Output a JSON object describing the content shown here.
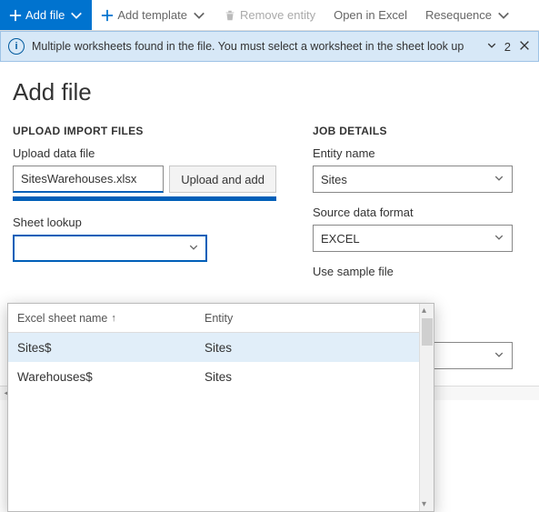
{
  "toolbar": {
    "add_file": "Add file",
    "add_template": "Add template",
    "remove_entity": "Remove entity",
    "open_in_excel": "Open in Excel",
    "resequence": "Resequence"
  },
  "messagebar": {
    "text": "Multiple worksheets found in the file. You must select a worksheet in the sheet look up",
    "count": "2"
  },
  "page": {
    "title": "Add file"
  },
  "upload": {
    "section": "UPLOAD IMPORT FILES",
    "file_label": "Upload data file",
    "file_value": "SitesWarehouses.xlsx",
    "upload_add": "Upload and add",
    "sheet_lookup_label": "Sheet lookup",
    "sheet_lookup_value": ""
  },
  "job": {
    "section": "JOB DETAILS",
    "entity_label": "Entity name",
    "entity_value": "Sites",
    "source_format_label": "Source data format",
    "source_format_value": "EXCEL",
    "use_sample_label": "Use sample file"
  },
  "lookup": {
    "col1": "Excel sheet name",
    "col2": "Entity",
    "rows": [
      {
        "sheet": "Sites$",
        "entity": "Sites",
        "selected": true
      },
      {
        "sheet": "Warehouses$",
        "entity": "Sites",
        "selected": false
      }
    ]
  }
}
